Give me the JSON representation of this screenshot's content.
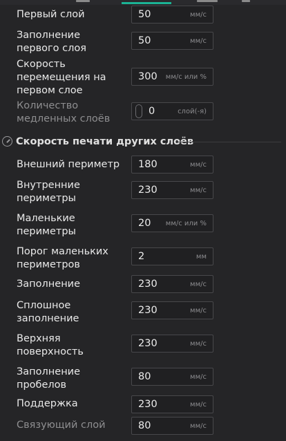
{
  "first_layer": {
    "rows": [
      {
        "label": "Первый слой",
        "value": "50",
        "unit": "мм/с"
      },
      {
        "label": "Заполнение первого слоя",
        "value": "50",
        "unit": "мм/с"
      },
      {
        "label": "Скорость перемещения на первом слое",
        "value": "300",
        "unit": "мм/с или %"
      },
      {
        "label": "Количество медленных слоёв",
        "value": "0",
        "unit": "слой(-я)"
      }
    ]
  },
  "section": {
    "title": "Скорость печати других слоёв",
    "icon": "speedometer-icon"
  },
  "other_layers": {
    "rows": [
      {
        "label": "Внешний периметр",
        "value": "180",
        "unit": "мм/с"
      },
      {
        "label": "Внутренние периметры",
        "value": "230",
        "unit": "мм/с"
      },
      {
        "label": "Маленькие периметры",
        "value": "20",
        "unit": "мм/с или %"
      },
      {
        "label": "Порог маленьких периметров",
        "value": "2",
        "unit": "мм"
      },
      {
        "label": "Заполнение",
        "value": "230",
        "unit": "мм/с"
      },
      {
        "label": "Сплошное заполнение",
        "value": "230",
        "unit": "мм/с"
      },
      {
        "label": "Верхняя поверхность",
        "value": "230",
        "unit": "мм/с"
      },
      {
        "label": "Заполнение пробелов",
        "value": "80",
        "unit": "мм/с"
      },
      {
        "label": "Поддержка",
        "value": "230",
        "unit": "мм/с"
      },
      {
        "label": "Связующий слой",
        "value": "80",
        "unit": "мм/с"
      }
    ]
  },
  "colors": {
    "accent": "#1bb394",
    "background": "#252527",
    "field_bg": "#202022"
  }
}
